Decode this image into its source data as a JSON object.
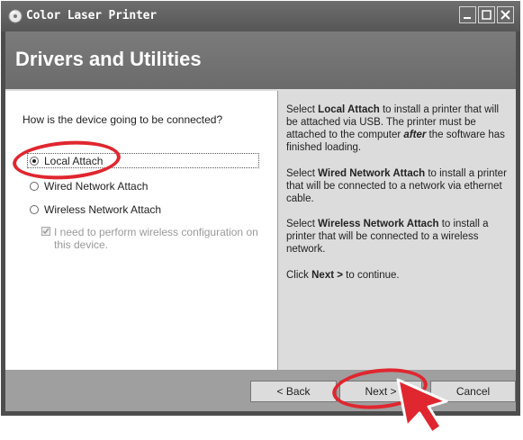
{
  "window": {
    "title": "Color Laser Printer",
    "title_icon": "printer-cd-icon"
  },
  "banner": {
    "title": "Drivers and Utilities"
  },
  "left_panel": {
    "question": "How is the device going to be connected?",
    "options": [
      {
        "label": "Local Attach",
        "selected": true
      },
      {
        "label": "Wired Network Attach",
        "selected": false
      },
      {
        "label": "Wireless Network Attach",
        "selected": false
      }
    ],
    "wireless_config_checkbox": {
      "label": "I need to perform wireless configuration on this device.",
      "checked": true,
      "disabled": true
    }
  },
  "right_panel": {
    "paragraphs": [
      {
        "prefix": "Select ",
        "bold": "Local Attach",
        "middle": " to install a printer that will be attached via USB. The printer must be attached to the computer ",
        "bold_italic": "after",
        "suffix": " the software has finished loading."
      },
      {
        "prefix": "Select ",
        "bold": "Wired Network Attach",
        "suffix": " to install a printer that will be connected to a network via ethernet cable."
      },
      {
        "prefix": "Select ",
        "bold": "Wireless Network Attach",
        "suffix": " to install a printer that will be connected to a wireless network."
      },
      {
        "prefix": "Click ",
        "bold": "Next >",
        "suffix": " to continue."
      }
    ]
  },
  "footer": {
    "back_label": "< Back",
    "next_label": "Next >",
    "cancel_label": "Cancel"
  },
  "colors": {
    "highlight": "#e0262f",
    "titlebar": "#5f5f5f",
    "banner": "#737373",
    "footer": "#9f9f9f",
    "help_panel": "#dcdcdc"
  }
}
